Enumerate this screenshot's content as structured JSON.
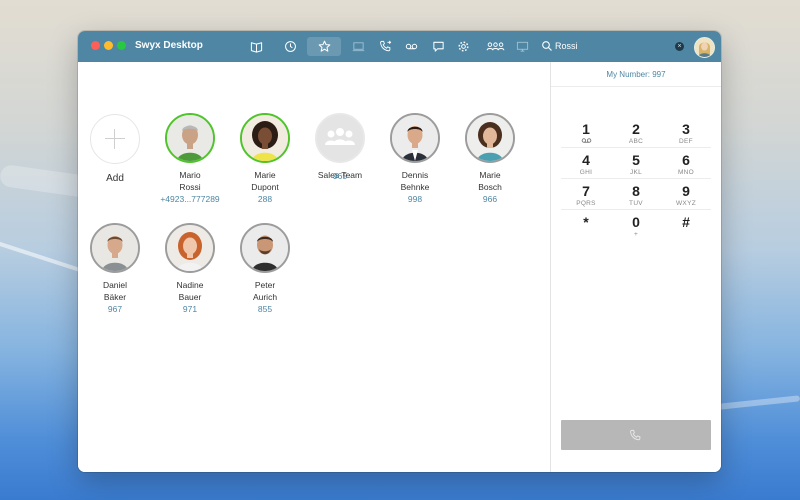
{
  "window": {
    "title": "Swyx Desktop"
  },
  "toolbar": {
    "icons": [
      "phonebook-icon",
      "history-icon",
      "favorites-icon",
      "voicemail-box-icon",
      "call-forward-icon",
      "voicemail-icon",
      "chat-icon",
      "settings-icon",
      "team-icon",
      "screen-icon"
    ],
    "active": "favorites-icon"
  },
  "search": {
    "value": "Rossi"
  },
  "colors": {
    "titlebar": "#4e86a3",
    "accent": "#4e86a3",
    "online": "#4fc42b",
    "call_button": "#b7b7b7"
  },
  "favorites": {
    "add_label": "Add",
    "contacts": [
      {
        "first": "Mario",
        "last": "Rossi",
        "number": "+4923...777289",
        "status": "online"
      },
      {
        "first": "Marie",
        "last": "Dupont",
        "number": "288",
        "status": "online"
      },
      {
        "first": "Sales Team",
        "last": "",
        "number": "965",
        "status": "group"
      },
      {
        "first": "Dennis",
        "last": "Behnke",
        "number": "998",
        "status": "offline"
      },
      {
        "first": "Marie",
        "last": "Bosch",
        "number": "966",
        "status": "offline"
      },
      {
        "first": "Daniel",
        "last": "Bäker",
        "number": "967",
        "status": "offline"
      },
      {
        "first": "Nadine",
        "last": "Bauer",
        "number": "971",
        "status": "offline"
      },
      {
        "first": "Peter",
        "last": "Aurich",
        "number": "855",
        "status": "offline"
      }
    ]
  },
  "dialpad": {
    "my_number": "My Number: 997",
    "keys": [
      {
        "digit": "1",
        "letters": ""
      },
      {
        "digit": "2",
        "letters": "ABC"
      },
      {
        "digit": "3",
        "letters": "DEF"
      },
      {
        "digit": "4",
        "letters": "GHI"
      },
      {
        "digit": "5",
        "letters": "JKL"
      },
      {
        "digit": "6",
        "letters": "MNO"
      },
      {
        "digit": "7",
        "letters": "PQRS"
      },
      {
        "digit": "8",
        "letters": "TUV"
      },
      {
        "digit": "9",
        "letters": "WXYZ"
      },
      {
        "digit": "*",
        "letters": ""
      },
      {
        "digit": "0",
        "letters": "+"
      },
      {
        "digit": "#",
        "letters": ""
      }
    ]
  }
}
